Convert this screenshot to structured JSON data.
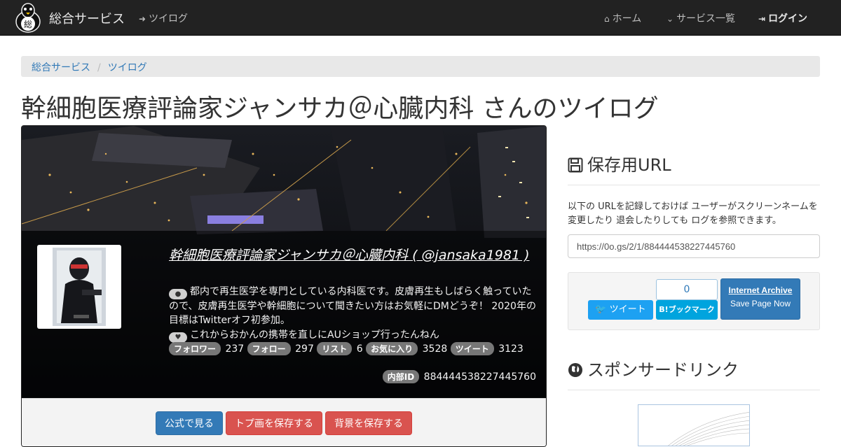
{
  "navbar": {
    "brand": "総合サービス",
    "brand_logo_char": "総",
    "twilog_link": "ツイログ",
    "home": "ホーム",
    "services": "サービス一覧",
    "login": "ログイン"
  },
  "breadcrumb": [
    "総合サービス",
    "ツイログ"
  ],
  "page_title": "幹細胞医療評論家ジャンサカ＠心臓内科 さんのツイログ",
  "profile": {
    "name_line": "幹細胞医療評論家ジャンサカ＠心臓内科 ( @jansaka1981 )",
    "bio": "都内で再生医学を専門としている内科医です。皮膚再生もしばらく触っていたので、皮膚再生医学や幹細胞について聞きたい方はお気軽にDMどうぞ！ 2020年の目標はTwitterオフ初参加。",
    "status": "これからおかんの携帯を直しにAUショップ行ったんねん",
    "stats": [
      {
        "label": "フォロワー",
        "value": "237"
      },
      {
        "label": "フォロー",
        "value": "297"
      },
      {
        "label": "リスト",
        "value": "6"
      },
      {
        "label": "お気に入り",
        "value": "3528"
      },
      {
        "label": "ツイート",
        "value": "3123"
      }
    ],
    "internal_id_label": "内部ID",
    "internal_id": "884444538227445760"
  },
  "actions": {
    "official": "公式で見る",
    "save_top": "トプ画を保存する",
    "save_bg": "背景を保存する"
  },
  "sidebar": {
    "save_url_heading": "保存用URL",
    "save_url_desc": "以下の URLを記録しておけば ユーザーがスクリーンネームを変更したり 退会したりしても ログを参照できます。",
    "save_url_value": "https://0o.gs/2/1/884444538227445760",
    "tweet_button": "ツイート",
    "hatena_count": "0",
    "hatena_button": "B!ブックマーク",
    "ia_title": "Internet Archive",
    "ia_sub": "Save Page Now",
    "sponsored_heading": "スポンサードリンク"
  },
  "colors": {
    "navbar": "#222222",
    "primary": "#337ab7",
    "danger": "#d9534f",
    "twitter": "#1da1f2",
    "hatena": "#00a4de"
  }
}
